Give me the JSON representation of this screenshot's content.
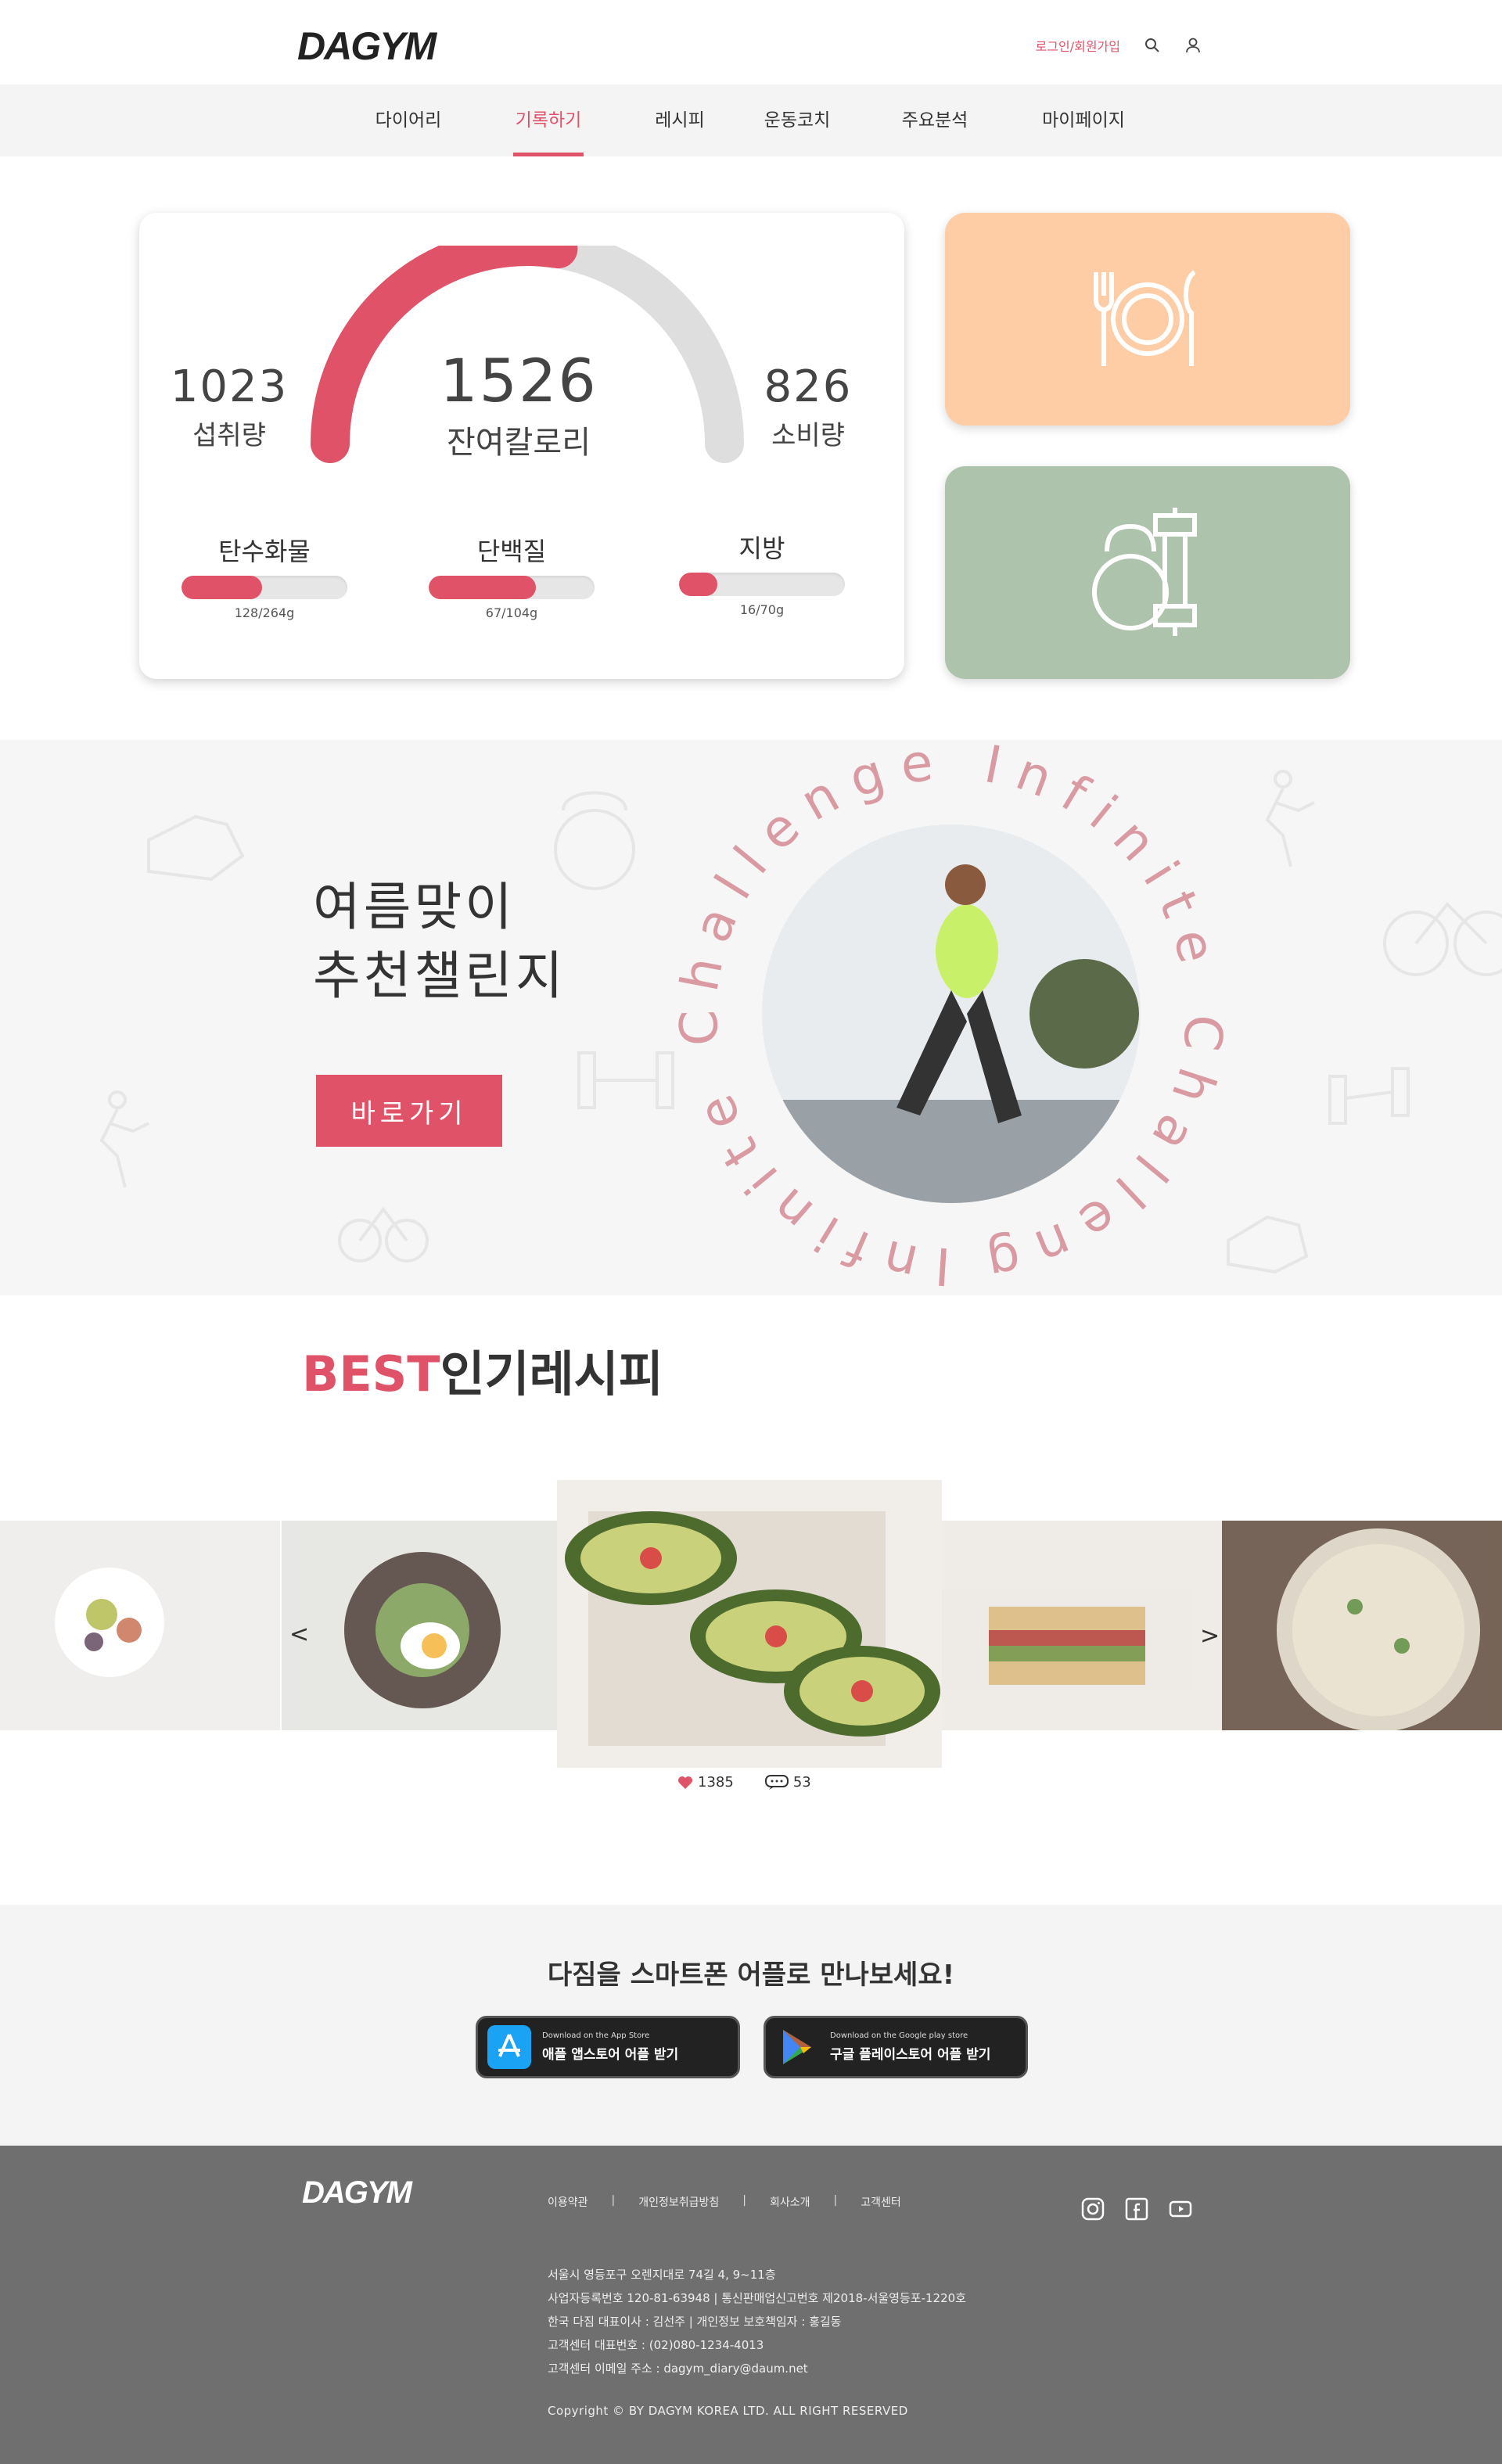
{
  "header": {
    "logo": "DAGYM",
    "login_label": "로그인/회원가입",
    "search_icon": "search-icon",
    "user_icon": "user-icon"
  },
  "nav": {
    "items": [
      {
        "label": "다이어리",
        "active": false
      },
      {
        "label": "기록하기",
        "active": true
      },
      {
        "label": "레시피",
        "active": false
      },
      {
        "label": "운동코치",
        "active": false
      },
      {
        "label": "주요분석",
        "active": false
      },
      {
        "label": "마이페이지",
        "active": false
      }
    ]
  },
  "calories": {
    "intake_value": "1023",
    "intake_label": "섭취량",
    "remaining_value": "1526",
    "remaining_label": "잔여칼로리",
    "burned_value": "826",
    "burned_label": "소비량",
    "gauge_fraction": 0.55
  },
  "macros": [
    {
      "label": "탄수화물",
      "value": "128/264g",
      "fraction": 0.485
    },
    {
      "label": "단백질",
      "value": "67/104g",
      "fraction": 0.644
    },
    {
      "label": "지방",
      "value": "16/70g",
      "fraction": 0.229
    }
  ],
  "tiles": {
    "meal_icon": "plate-fork-knife-icon",
    "exercise_icon": "kettlebell-dumbbell-icon",
    "colors": {
      "meal": "#fecda6",
      "exercise": "#aec3ab"
    }
  },
  "challenge": {
    "title_line1": "여름맞이",
    "title_line2": "추천챌린지",
    "button_label": "바로가기",
    "ring_text": "Infinite Challenge Infinite Challenge "
  },
  "recipes": {
    "title_accent": "BEST",
    "title_rest": "인기레시피",
    "likes": "1385",
    "comments": "53",
    "prev_label": "<",
    "next_label": ">"
  },
  "app": {
    "title": "다짐을 스마트폰 어플로 만나보세요!",
    "appstore_small": "Download on the App Store",
    "appstore_label": "애플 앱스토어 어플 받기",
    "playstore_small": "Download on the Google play store",
    "playstore_label": "구글 플레이스토어 어플 받기"
  },
  "footer": {
    "logo": "DAGYM",
    "links": [
      "이용약관",
      "개인정보취급방침",
      "회사소개",
      "고객센터"
    ],
    "separator": "|",
    "info": [
      "서울시 영등포구 오렌지대로 74길 4, 9~11층",
      "사업자등록번호 120-81-63948  |  통신판매업신고번호 제2018-서울영등포-1220호",
      "한국 다짐 대표이사 : 김선주  |  개인정보 보호책임자 : 홍길동",
      "고객센터 대표번호 : (02)080-1234-4013",
      "고객센터 이메일 주소 : dagym_diary@daum.net"
    ],
    "copyright": "Copyright © BY DAGYM KOREA LTD. ALL RIGHT RESERVED",
    "social_icons": [
      "instagram-icon",
      "facebook-icon",
      "youtube-icon"
    ]
  },
  "colors": {
    "accent": "#e05268",
    "nav_bg": "#f4f4f4",
    "footer_bg": "#6f6f6f"
  }
}
